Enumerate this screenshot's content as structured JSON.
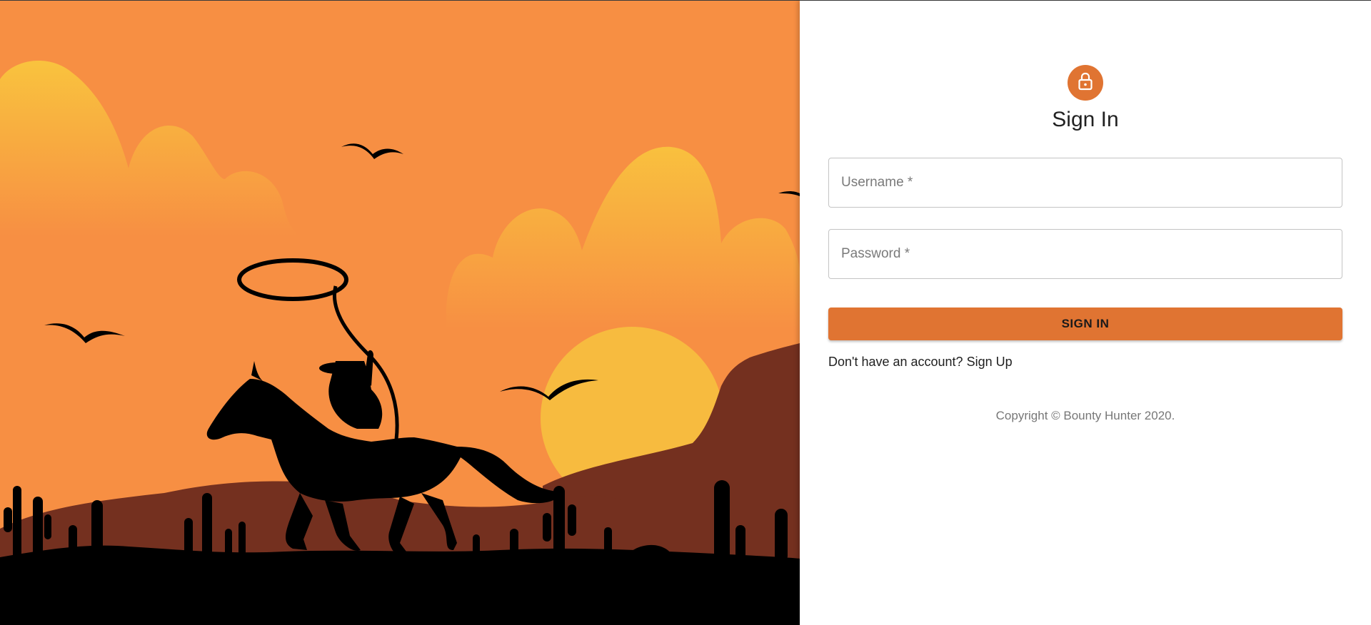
{
  "hero": {
    "colors": {
      "sky": "#f78f43",
      "cloud_top": "#f9c33e",
      "sun": "#f7bb3f",
      "mountain": "#74301f",
      "silhouette": "#000000"
    }
  },
  "signin": {
    "icon": "lock-icon",
    "title": "Sign In",
    "username_placeholder": "Username *",
    "password_placeholder": "Password *",
    "submit_label": "SIGN IN",
    "signup_link": "Don't have an account? Sign Up",
    "copyright": "Copyright © Bounty Hunter 2020.",
    "accent_color": "#e07432"
  }
}
